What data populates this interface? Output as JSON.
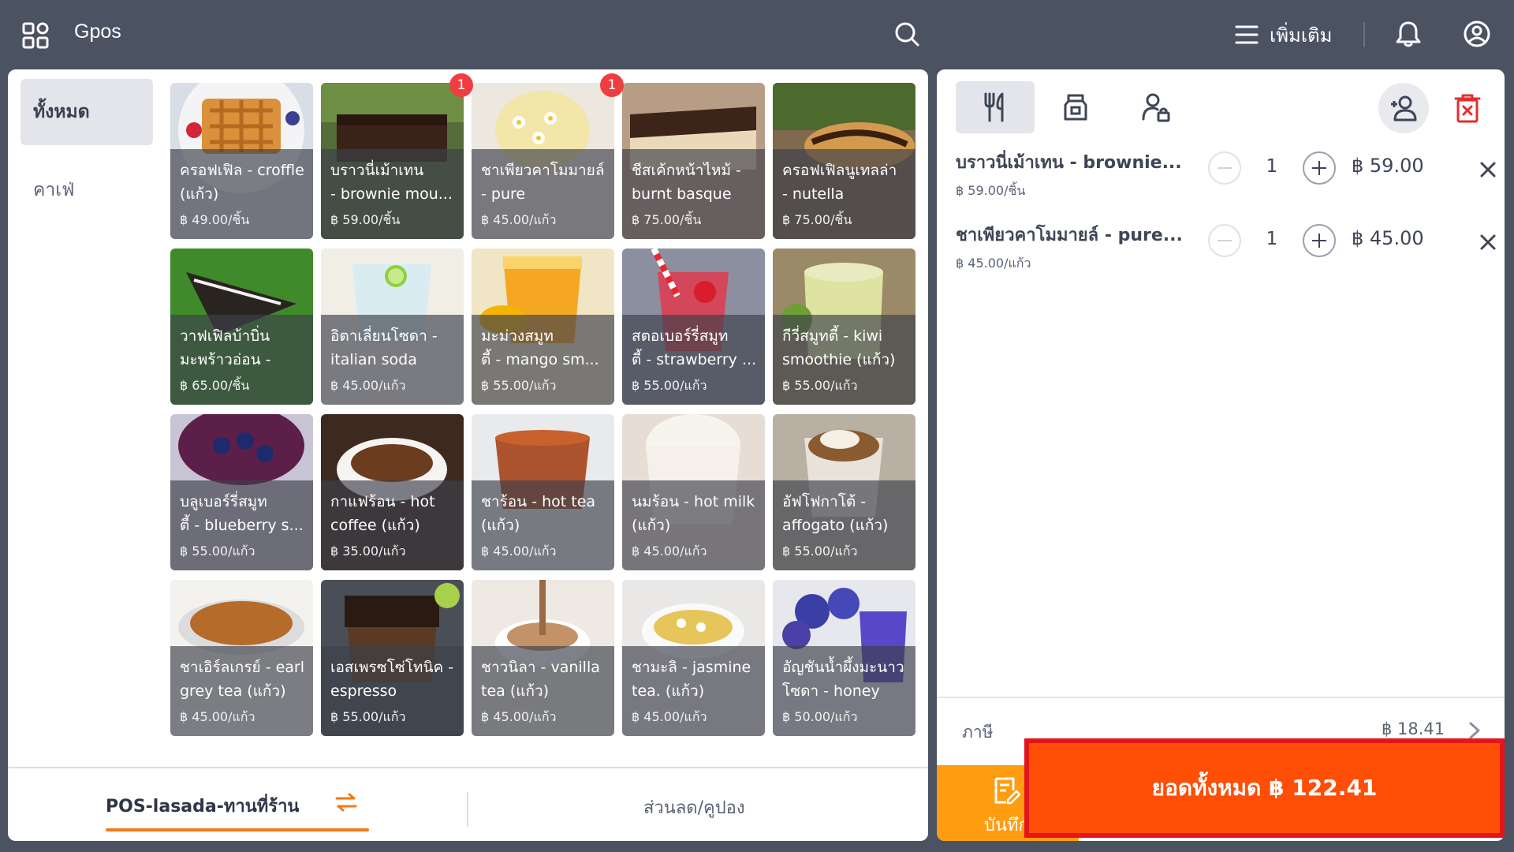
{
  "header": {
    "app_title": "Gpos",
    "more_label": "เพิ่มเติม"
  },
  "categories": [
    {
      "label": "ทั้งหมด",
      "active": true
    },
    {
      "label": "คาเฟ่",
      "active": false
    }
  ],
  "products": [
    {
      "name": "ครอฟเฟิล - croffle\n(แก้ว)",
      "price": "฿ 49.00/ชิ้น",
      "img": "waffle",
      "badge": ""
    },
    {
      "name": "บราวนี่เม้าเทน\n- brownie mou...",
      "price": "฿ 59.00/ชิ้น",
      "img": "brownie",
      "badge": "1"
    },
    {
      "name": "ชาเพียวคาโมมายล์\n- pure camomil...",
      "price": "฿ 45.00/แก้ว",
      "img": "camomile",
      "badge": "1"
    },
    {
      "name": "ชีสเค้กหน้าไหม้ -\nburnt basque c...",
      "price": "฿ 75.00/ชิ้น",
      "img": "basque",
      "badge": ""
    },
    {
      "name": "ครอฟเฟิลนูเทลล่า\n- nutella croffle...",
      "price": "฿ 75.00/ชิ้น",
      "img": "nutella",
      "badge": ""
    },
    {
      "name": "วาฟเฟิลบ้าบิ่น\nมะพร้าวอ่อน - ba...",
      "price": "฿ 65.00/ชิ้น",
      "img": "pandan",
      "badge": ""
    },
    {
      "name": "อิตาเลี่ยนโซดา -\nitalian soda (แก้ว)",
      "price": "฿ 45.00/แก้ว",
      "img": "soda",
      "badge": ""
    },
    {
      "name": "มะม่วงสมูท\nตี้ - mango sm...",
      "price": "฿ 55.00/แก้ว",
      "img": "mango",
      "badge": ""
    },
    {
      "name": "สตอเบอร์รี่สมูท\nตี้ - strawberry ...",
      "price": "฿ 55.00/แก้ว",
      "img": "strawberry",
      "badge": ""
    },
    {
      "name": "กีวี่สมูทตี้ - kiwi\nsmoothie (แก้ว)",
      "price": "฿ 55.00/แก้ว",
      "img": "kiwi",
      "badge": ""
    },
    {
      "name": "บลูเบอร์รี่สมูท\nตี้ - blueberry s...",
      "price": "฿ 55.00/แก้ว",
      "img": "blueberry",
      "badge": ""
    },
    {
      "name": "กาแฟร้อน - hot\ncoffee (แก้ว)",
      "price": "฿ 35.00/แก้ว",
      "img": "coffee",
      "badge": ""
    },
    {
      "name": "ชาร้อน - hot tea\n(แก้ว)",
      "price": "฿ 45.00/แก้ว",
      "img": "tea",
      "badge": ""
    },
    {
      "name": "นมร้อน - hot milk\n(แก้ว)",
      "price": "฿ 45.00/แก้ว",
      "img": "milk",
      "badge": ""
    },
    {
      "name": "อัฟโฟกาโต้ -\naffogato (แก้ว)",
      "price": "฿ 55.00/แก้ว",
      "img": "affogato",
      "badge": ""
    },
    {
      "name": "ชาเอิร์ลเกรย์ - earl\ngrey tea (แก้ว)",
      "price": "฿ 45.00/แก้ว",
      "img": "earlgrey",
      "badge": ""
    },
    {
      "name": "เอสเพรซโซ่โทนิค -\nespresso tonic....",
      "price": "฿ 55.00/แก้ว",
      "img": "tonic",
      "badge": ""
    },
    {
      "name": "ชาวนิลา - vanilla\ntea (แก้ว)",
      "price": "฿ 45.00/แก้ว",
      "img": "vanilla",
      "badge": ""
    },
    {
      "name": "ชามะลิ - jasmine\ntea. (แก้ว)",
      "price": "฿ 45.00/แก้ว",
      "img": "jasmine",
      "badge": ""
    },
    {
      "name": "อัญชันน้ำผึ้งมะนาว\nโซดา - honey le...",
      "price": "฿ 50.00/แก้ว",
      "img": "butterfly",
      "badge": ""
    }
  ],
  "footer": {
    "pos_tab": "POS-lasada-ทานที่ร้าน",
    "discount_tab": "ส่วนลด/คูปอง"
  },
  "order": {
    "lines": [
      {
        "name": "บราวนี่เม้าเทน - brownie...",
        "unit": "฿ 59.00/ชิ้น",
        "qty": "1",
        "total": "฿ 59.00"
      },
      {
        "name": "ชาเพียวคาโมมายล์ - pure...",
        "unit": "฿ 45.00/แก้ว",
        "qty": "1",
        "total": "฿ 45.00"
      }
    ],
    "tax_label": "ภาษี",
    "tax_value": "฿ 18.41",
    "save_label": "บันทึก",
    "total_label": "ยอดทั้งหมด ฿ 122.41"
  },
  "colors": {
    "accent": "#ff9c10",
    "total": "#ff4e06",
    "highlight_border": "#e3141a",
    "badge": "#ef3e42",
    "topbar": "#4b5262"
  }
}
